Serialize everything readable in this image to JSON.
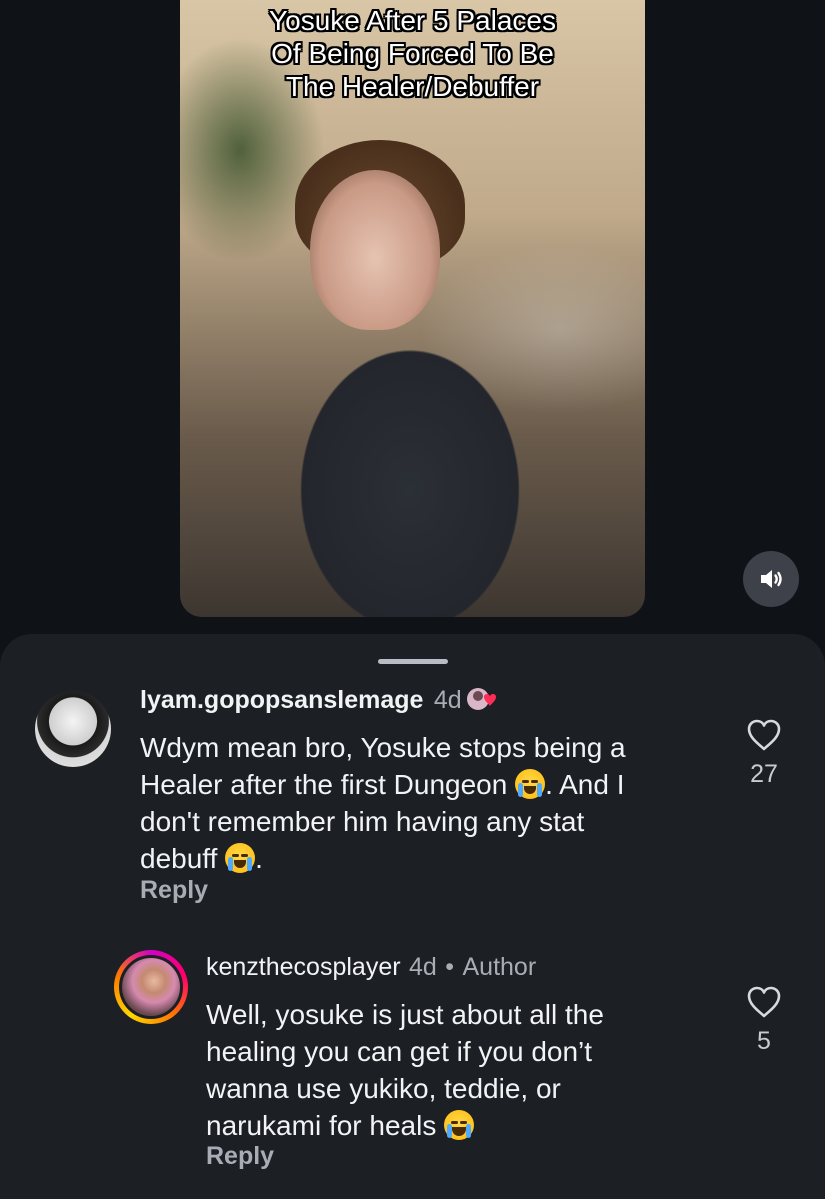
{
  "video": {
    "caption_lines": [
      "Yosuke After 5 Palaces",
      "Of Being Forced To Be",
      "The Healer/Debuffer"
    ]
  },
  "icons": {
    "volume": "speaker-icon",
    "like": "heart-outline-icon",
    "cry": "loudly-crying-face",
    "laugh": "face-with-tears-of-joy",
    "badge": "profile-heart-badge"
  },
  "colors": {
    "sheet_bg": "#1c1f24",
    "page_bg": "#0f1217",
    "muted_text": "#a8adb5",
    "heart_badge": "#ff2d55"
  },
  "comments": [
    {
      "username": "lyam.gopopsanslemage",
      "age": "4d",
      "text_parts": [
        "Wdym mean bro, Yosuke stops being a",
        "Healer after the first Dungeon",
        ". And I",
        "don't remember him having any stat",
        "debuff",
        "."
      ],
      "reply_label": "Reply",
      "likes": "27"
    },
    {
      "username": "kenzthecosplayer",
      "age": "4d",
      "separator": "•",
      "author_tag": "Author",
      "text_lines": [
        "Well, yosuke is just about all the",
        "healing you can get if you don’t",
        "wanna use yukiko, teddie, or",
        "narukami for heals"
      ],
      "reply_label": "Reply",
      "likes": "5"
    }
  ]
}
